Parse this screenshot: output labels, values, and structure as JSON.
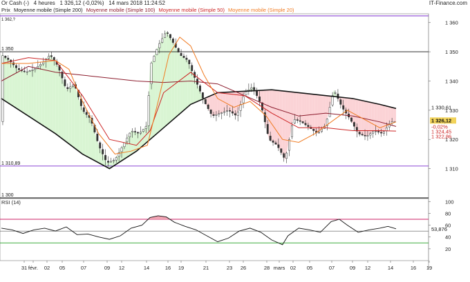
{
  "header": {
    "instrument": "Or Cash (-)",
    "timeframe": "4 heures",
    "last_price": "1 326,12 (-0,02%)",
    "datetime": "14 mars 2018 11:24:52",
    "source": "IT-Finance.com"
  },
  "legend": [
    {
      "label": "Prix",
      "color": "#222222"
    },
    {
      "label": "Moyenne mobile (Simple 200)",
      "color": "#111111"
    },
    {
      "label": "Moyenne mobile (Simple 100)",
      "color": "#8b1a2b"
    },
    {
      "label": "Moyenne mobile (Simple 50)",
      "color": "#cc2222"
    },
    {
      "label": "Moyenne mobile (Simple 20)",
      "color": "#f07a20"
    }
  ],
  "chart_data": [
    {
      "type": "line",
      "panel": "price",
      "ylim": [
        1300,
        1363
      ],
      "yticks": [
        "1 310",
        "1 320",
        "1 330",
        "1 340",
        "1 350",
        "1 360"
      ],
      "xticks": [
        "31",
        "févr.",
        "02",
        "05",
        "07",
        "09",
        "12",
        "14",
        "16",
        "19",
        "21",
        "23",
        "26",
        "28",
        "mars",
        "02",
        "05",
        "07",
        "09",
        "12",
        "14",
        "16",
        "19"
      ],
      "x_index_range": [
        0,
        150
      ],
      "horizontal_lines": [
        {
          "label": "1 350",
          "value": 1350,
          "color": "#111111"
        },
        {
          "label": "1 310,89",
          "value": 1310.89,
          "color": "#7b2ccf"
        },
        {
          "label": "1 300",
          "value": 1300,
          "color": "#111111"
        }
      ],
      "top_boundary": {
        "label": "1 362,?",
        "value": 1362.3,
        "color": "#7b2ccf"
      },
      "price_labels": [
        {
          "label": "1 330,61",
          "value": 1330.61,
          "color": "#111111",
          "bg": "#ffffff"
        },
        {
          "label": "1 326,12",
          "value": 1326.12,
          "color": "#111111",
          "bg": "#f2d35a"
        },
        {
          "label": "-0,02%",
          "value": 1325.0,
          "color": "#cc2222",
          "bg": "#ffffff"
        },
        {
          "label": "1 324,45",
          "value": 1324.45,
          "color": "#cc2222",
          "bg": "#ffffff"
        },
        {
          "label": "1 322,86",
          "value": 1322.86,
          "color": "#cc2222",
          "bg": "#ffffff"
        }
      ],
      "series": [
        {
          "key": "price",
          "color": "#222222",
          "points": [
            [
              0,
              1349
            ],
            [
              3,
              1347
            ],
            [
              6,
              1344
            ],
            [
              9,
              1343
            ],
            [
              12,
              1344
            ],
            [
              15,
              1346
            ],
            [
              18,
              1349
            ],
            [
              21,
              1345
            ],
            [
              24,
              1337
            ],
            [
              27,
              1339
            ],
            [
              30,
              1330
            ],
            [
              33,
              1327
            ],
            [
              36,
              1318
            ],
            [
              39,
              1312
            ],
            [
              42,
              1313
            ],
            [
              45,
              1318
            ],
            [
              48,
              1323
            ],
            [
              51,
              1322
            ],
            [
              54,
              1325
            ],
            [
              55,
              1345
            ],
            [
              58,
              1352
            ],
            [
              61,
              1357
            ],
            [
              63,
              1354
            ],
            [
              66,
              1349
            ],
            [
              69,
              1347
            ],
            [
              72,
              1340
            ],
            [
              75,
              1333
            ],
            [
              78,
              1328
            ],
            [
              81,
              1329
            ],
            [
              84,
              1330
            ],
            [
              87,
              1328
            ],
            [
              90,
              1336
            ],
            [
              93,
              1338
            ],
            [
              96,
              1332
            ],
            [
              99,
              1320
            ],
            [
              102,
              1318
            ],
            [
              105,
              1313
            ],
            [
              108,
              1327
            ],
            [
              111,
              1326
            ],
            [
              114,
              1324
            ],
            [
              117,
              1322
            ],
            [
              120,
              1325
            ],
            [
              123,
              1337
            ],
            [
              126,
              1331
            ],
            [
              129,
              1327
            ],
            [
              132,
              1322
            ],
            [
              135,
              1321
            ],
            [
              138,
              1323
            ],
            [
              141,
              1322
            ],
            [
              144,
              1326
            ],
            [
              146,
              1326.12
            ]
          ]
        },
        {
          "key": "sma200",
          "color": "#111111",
          "width": 1.6,
          "points": [
            [
              0,
              1334
            ],
            [
              10,
              1328
            ],
            [
              20,
              1322
            ],
            [
              30,
              1315
            ],
            [
              40,
              1310
            ],
            [
              50,
              1316
            ],
            [
              60,
              1324
            ],
            [
              70,
              1332
            ],
            [
              80,
              1336
            ],
            [
              90,
              1336.5
            ],
            [
              100,
              1337
            ],
            [
              110,
              1336
            ],
            [
              120,
              1335
            ],
            [
              130,
              1334
            ],
            [
              140,
              1332
            ],
            [
              146,
              1330.61
            ]
          ]
        },
        {
          "key": "sma100",
          "color": "#8b1a2b",
          "width": 1.0,
          "points": [
            [
              0,
              1340
            ],
            [
              10,
              1345
            ],
            [
              20,
              1343
            ],
            [
              30,
              1342
            ],
            [
              40,
              1341
            ],
            [
              50,
              1340
            ],
            [
              60,
              1339.5
            ],
            [
              70,
              1340
            ],
            [
              80,
              1339
            ],
            [
              90,
              1335
            ],
            [
              100,
              1331
            ],
            [
              110,
              1328
            ],
            [
              120,
              1329
            ],
            [
              130,
              1328
            ],
            [
              140,
              1326
            ],
            [
              146,
              1324.45
            ]
          ]
        },
        {
          "key": "sma50",
          "color": "#cc2222",
          "width": 1.0,
          "points": [
            [
              0,
              1346
            ],
            [
              10,
              1348
            ],
            [
              20,
              1347
            ],
            [
              30,
              1335
            ],
            [
              40,
              1320
            ],
            [
              50,
              1318
            ],
            [
              55,
              1323
            ],
            [
              60,
              1336
            ],
            [
              70,
              1343
            ],
            [
              80,
              1336
            ],
            [
              90,
              1335
            ],
            [
              100,
              1329
            ],
            [
              110,
              1324
            ],
            [
              120,
              1324
            ],
            [
              130,
              1323
            ],
            [
              140,
              1323
            ],
            [
              146,
              1322.86
            ]
          ]
        },
        {
          "key": "sma20",
          "color": "#f07a20",
          "width": 1.0,
          "points": [
            [
              0,
              1346
            ],
            [
              10,
              1346
            ],
            [
              20,
              1347
            ],
            [
              25,
              1344
            ],
            [
              30,
              1333
            ],
            [
              36,
              1322
            ],
            [
              42,
              1315
            ],
            [
              48,
              1316
            ],
            [
              54,
              1318
            ],
            [
              58,
              1333
            ],
            [
              62,
              1349
            ],
            [
              66,
              1355
            ],
            [
              70,
              1352
            ],
            [
              75,
              1342
            ],
            [
              80,
              1334
            ],
            [
              86,
              1331
            ],
            [
              92,
              1333
            ],
            [
              98,
              1328
            ],
            [
              104,
              1320
            ],
            [
              110,
              1319
            ],
            [
              116,
              1322
            ],
            [
              122,
              1326
            ],
            [
              128,
              1330
            ],
            [
              134,
              1327
            ],
            [
              140,
              1324
            ],
            [
              146,
              1326
            ]
          ]
        }
      ]
    },
    {
      "type": "line",
      "panel": "rsi",
      "title": "RSI (14)",
      "ylim": [
        0,
        105
      ],
      "yticks": [
        "20",
        "40",
        "60",
        "80",
        "100"
      ],
      "bands": [
        {
          "label": "70",
          "value": 70,
          "color": "#cc2266"
        },
        {
          "label": "30",
          "value": 30,
          "color": "#22a022"
        }
      ],
      "last_value_label": "53,876",
      "last_value": 53.876,
      "series": [
        {
          "key": "rsi",
          "color": "#111111",
          "points": [
            [
              0,
              55
            ],
            [
              4,
              52
            ],
            [
              8,
              46
            ],
            [
              12,
              52
            ],
            [
              16,
              55
            ],
            [
              20,
              50
            ],
            [
              24,
              57
            ],
            [
              28,
              44
            ],
            [
              32,
              45
            ],
            [
              36,
              40
            ],
            [
              40,
              36
            ],
            [
              44,
              42
            ],
            [
              48,
              55
            ],
            [
              52,
              60
            ],
            [
              55,
              73
            ],
            [
              58,
              76
            ],
            [
              61,
              74
            ],
            [
              64,
              65
            ],
            [
              68,
              58
            ],
            [
              72,
              52
            ],
            [
              76,
              42
            ],
            [
              80,
              32
            ],
            [
              84,
              38
            ],
            [
              88,
              50
            ],
            [
              92,
              55
            ],
            [
              96,
              48
            ],
            [
              100,
              35
            ],
            [
              104,
              27
            ],
            [
              106,
              42
            ],
            [
              110,
              55
            ],
            [
              114,
              52
            ],
            [
              118,
              48
            ],
            [
              122,
              66
            ],
            [
              125,
              70
            ],
            [
              128,
              60
            ],
            [
              132,
              48
            ],
            [
              136,
              52
            ],
            [
              140,
              55
            ],
            [
              143,
              58
            ],
            [
              146,
              53.876
            ]
          ]
        }
      ]
    }
  ]
}
